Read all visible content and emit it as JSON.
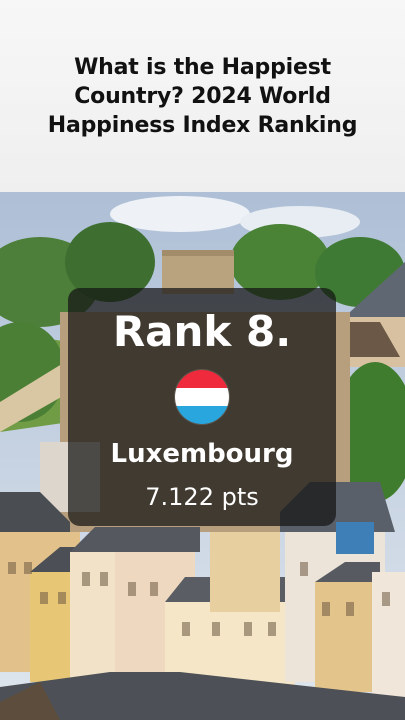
{
  "header": {
    "title": "What is the Happiest Country? 2024 World Happiness Index Ranking"
  },
  "card": {
    "rank_label": "Rank 8.",
    "country": "Luxembourg",
    "score": "7.122 pts",
    "flag_colors": [
      "#ee2a3c",
      "#ffffff",
      "#2aa6df"
    ]
  },
  "background": {
    "icon": "luxembourg-city-photo",
    "sky_color": "#c7d5e6",
    "foliage_color": "#3f7a34",
    "wall_color": "#e9d2a8"
  }
}
